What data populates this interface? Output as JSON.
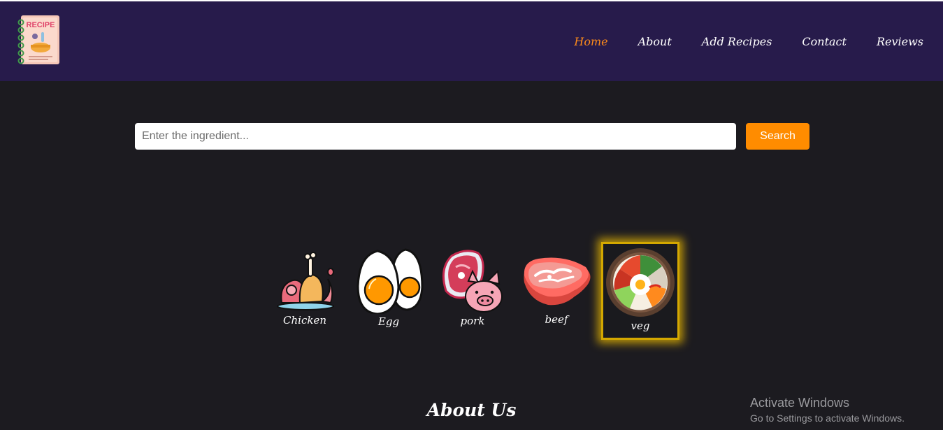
{
  "logo": {
    "text": "RECIPE"
  },
  "nav": {
    "items": [
      {
        "label": "Home",
        "active": true
      },
      {
        "label": "About"
      },
      {
        "label": "Add Recipes"
      },
      {
        "label": "Contact"
      },
      {
        "label": "Reviews"
      }
    ]
  },
  "search": {
    "placeholder": "Enter the ingredient...",
    "value": "",
    "button_label": "Search"
  },
  "categories": [
    {
      "label": "Chicken",
      "icon": "chicken-icon"
    },
    {
      "label": "Egg",
      "icon": "egg-icon"
    },
    {
      "label": "pork",
      "icon": "pork-icon"
    },
    {
      "label": "beef",
      "icon": "beef-icon"
    },
    {
      "label": "veg",
      "icon": "veg-bowl-icon",
      "selected": true
    }
  ],
  "about": {
    "heading": "About Us"
  },
  "watermark": {
    "line1": "Activate Windows",
    "line2": "Go to Settings to activate Windows."
  },
  "colors": {
    "navbar": "#271b4b",
    "background": "#1c1b20",
    "accent": "#ff8c00",
    "highlight": "#f0be00"
  }
}
